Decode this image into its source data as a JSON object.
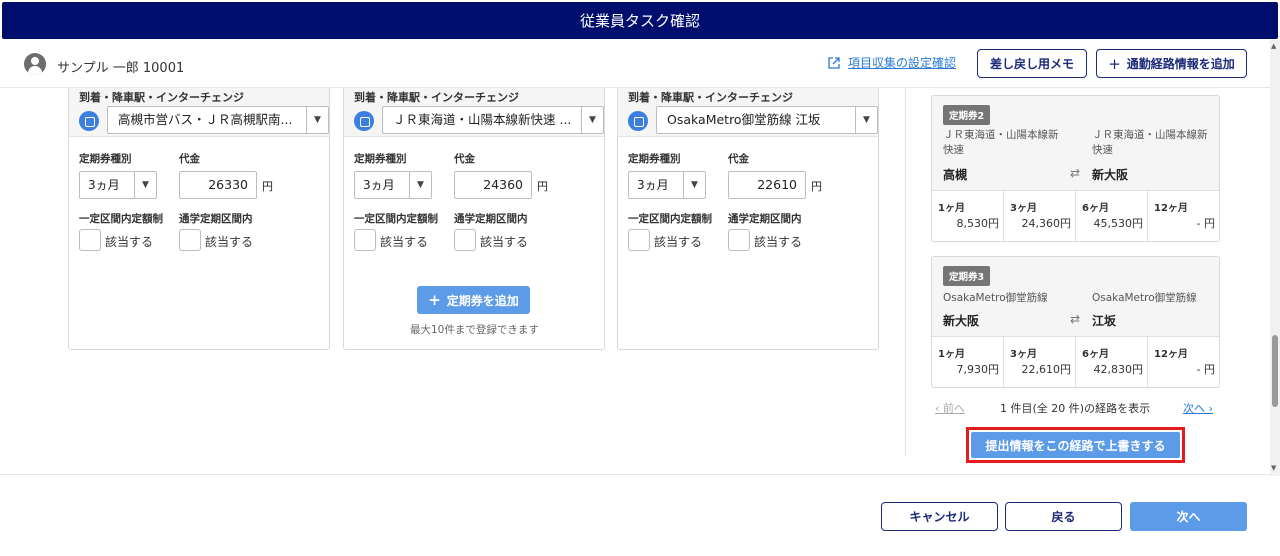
{
  "header": {
    "title": "従業員タスク確認"
  },
  "user": {
    "name": "サンプル 一郎 10001"
  },
  "toolbar": {
    "settings_link": "項目収集の設定確認",
    "memo_button": "差し戻し用メモ",
    "add_route_button": "通勤経路情報を追加"
  },
  "cards": [
    {
      "section_label": "到着・降車駅・インターチェンジ",
      "station": "高槻市営バス・ＪＲ高槻駅南...",
      "type_label": "定期券種別",
      "type_value": "3ヵ月",
      "price_label": "代金",
      "price_value": "26330",
      "yen": "円",
      "fixed_label": "一定区間内定額制",
      "commute_label": "通学定期区間内",
      "applies": "該当する"
    },
    {
      "section_label": "到着・降車駅・インターチェンジ",
      "station": "ＪＲ東海道・山陽本線新快速 ...",
      "type_label": "定期券種別",
      "type_value": "3ヵ月",
      "price_label": "代金",
      "price_value": "24360",
      "yen": "円",
      "fixed_label": "一定区間内定額制",
      "commute_label": "通学定期区間内",
      "applies": "該当する"
    },
    {
      "section_label": "到着・降車駅・インターチェンジ",
      "station": "OsakaMetro御堂筋線 江坂",
      "type_label": "定期券種別",
      "type_value": "3ヵ月",
      "price_label": "代金",
      "price_value": "22610",
      "yen": "円",
      "fixed_label": "一定区間内定額制",
      "commute_label": "通学定期区間内",
      "applies": "該当する"
    }
  ],
  "add_ticket": {
    "label": "定期券を追加",
    "note": "最大10件まで登録できます"
  },
  "routes": [
    {
      "tag": "定期券2",
      "from_line": "ＪＲ東海道・山陽本線新\n快速",
      "to_line": "ＪＲ東海道・山陽本線新\n快速",
      "from_station": "高槻",
      "to_station": "新大阪",
      "prices": [
        {
          "label": "1ヶ月",
          "value": "8,530円"
        },
        {
          "label": "3ヶ月",
          "value": "24,360円"
        },
        {
          "label": "6ヶ月",
          "value": "45,530円"
        },
        {
          "label": "12ヶ月",
          "value": "- 円"
        }
      ]
    },
    {
      "tag": "定期券3",
      "from_line": "OsakaMetro御堂筋線",
      "to_line": "OsakaMetro御堂筋線",
      "from_station": "新大阪",
      "to_station": "江坂",
      "prices": [
        {
          "label": "1ヶ月",
          "value": "7,930円"
        },
        {
          "label": "3ヶ月",
          "value": "22,610円"
        },
        {
          "label": "6ヶ月",
          "value": "42,830円"
        },
        {
          "label": "12ヶ月",
          "value": "- 円"
        }
      ]
    }
  ],
  "pager": {
    "prev": "‹ 前へ",
    "info": "1 件目(全 20 件)の経路を表示",
    "next": "次へ ›"
  },
  "overwrite_button": "提出情報をこの経路で上書きする",
  "footer": {
    "cancel": "キャンセル",
    "back": "戻る",
    "next": "次へ"
  },
  "colors": {
    "header_bg": "#000e6e",
    "primary": "#5b9be8",
    "highlight": "#e51b1b"
  }
}
